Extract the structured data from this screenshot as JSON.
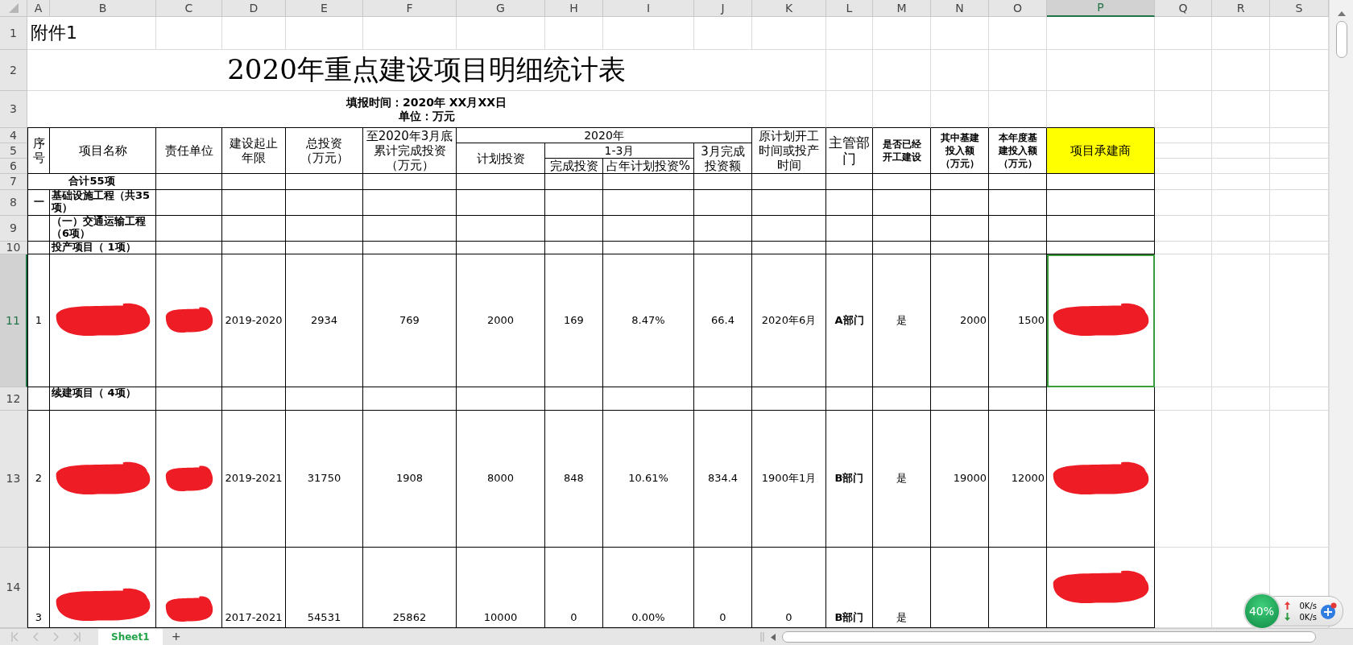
{
  "column_headers": [
    {
      "label": "A",
      "selected": false
    },
    {
      "label": "B",
      "selected": false
    },
    {
      "label": "C",
      "selected": false
    },
    {
      "label": "D",
      "selected": false
    },
    {
      "label": "E",
      "selected": false
    },
    {
      "label": "F",
      "selected": false
    },
    {
      "label": "G",
      "selected": false
    },
    {
      "label": "H",
      "selected": false
    },
    {
      "label": "I",
      "selected": false
    },
    {
      "label": "J",
      "selected": false
    },
    {
      "label": "K",
      "selected": false
    },
    {
      "label": "L",
      "selected": false
    },
    {
      "label": "M",
      "selected": false
    },
    {
      "label": "N",
      "selected": false
    },
    {
      "label": "O",
      "selected": false
    },
    {
      "label": "P",
      "selected": true
    },
    {
      "label": "Q",
      "selected": false
    },
    {
      "label": "R",
      "selected": false
    },
    {
      "label": "S",
      "selected": false
    }
  ],
  "row_headers": [
    {
      "label": "1",
      "selected": false
    },
    {
      "label": "2",
      "selected": false
    },
    {
      "label": "3",
      "selected": false
    },
    {
      "label": "4",
      "selected": false
    },
    {
      "label": "5",
      "selected": false
    },
    {
      "label": "6",
      "selected": false
    },
    {
      "label": "7",
      "selected": false
    },
    {
      "label": "8",
      "selected": false
    },
    {
      "label": "9",
      "selected": false
    },
    {
      "label": "10",
      "selected": false
    },
    {
      "label": "11",
      "selected": true
    },
    {
      "label": "12",
      "selected": false
    },
    {
      "label": "13",
      "selected": false
    },
    {
      "label": "14",
      "selected": false
    }
  ],
  "attachment": "附件1",
  "title": "2020年重点建设项目明细统计表",
  "report_date": "填报时间：2020年 XX月XX日",
  "unit": "单位：万元",
  "table_headers": [
    "序号",
    "项目名称",
    "责任单位",
    "建设起止年限",
    "总投资（万元）",
    "至2020年3月底累计完成投资（万元）",
    "2020年",
    "计划投资",
    "1-3月",
    "完成投资",
    "占年计划投资%",
    "3月完成投资额",
    "原计划开工时间或投产时间",
    "主管部门",
    "是否已经开工建设",
    "其中基建投入额（万元）",
    "本年度基建投入额（万元）",
    "项目承建商"
  ],
  "rows": [
    {
      "kind": "total",
      "label": "合计55项"
    },
    {
      "kind": "section",
      "number": "一",
      "label": "基础设施工程（共35项）"
    },
    {
      "kind": "section",
      "label": "（一）交通运输工程（6项）"
    },
    {
      "kind": "section",
      "label": "投产项目（ 1项）"
    },
    {
      "kind": "project",
      "cells": [
        {
          "kind": "text",
          "text": "1"
        },
        {
          "kind": "redacted"
        },
        {
          "kind": "redacted"
        },
        {
          "kind": "text",
          "text": "2019-2020"
        },
        {
          "kind": "text",
          "text": "2934"
        },
        {
          "kind": "text",
          "text": "769"
        },
        {
          "kind": "text",
          "text": "2000"
        },
        {
          "kind": "text",
          "text": "169"
        },
        {
          "kind": "text",
          "text": "8.47%"
        },
        {
          "kind": "text",
          "text": "66.4"
        },
        {
          "kind": "text",
          "text": "2020年6月"
        },
        {
          "kind": "text",
          "text": "A部门"
        },
        {
          "kind": "text",
          "text": "是"
        },
        {
          "kind": "text",
          "text": "2000"
        },
        {
          "kind": "text",
          "text": "1500"
        },
        {
          "kind": "redacted"
        }
      ]
    },
    {
      "kind": "section",
      "label": "续建项目（ 4项）"
    },
    {
      "kind": "project",
      "cells": [
        {
          "kind": "text",
          "text": "2"
        },
        {
          "kind": "redacted"
        },
        {
          "kind": "redacted"
        },
        {
          "kind": "text",
          "text": "2019-2021"
        },
        {
          "kind": "text",
          "text": "31750"
        },
        {
          "kind": "text",
          "text": "1908"
        },
        {
          "kind": "text",
          "text": "8000"
        },
        {
          "kind": "text",
          "text": "848"
        },
        {
          "kind": "text",
          "text": "10.61%"
        },
        {
          "kind": "text",
          "text": "834.4"
        },
        {
          "kind": "text",
          "text": "1900年1月"
        },
        {
          "kind": "text",
          "text": "B部门"
        },
        {
          "kind": "text",
          "text": "是"
        },
        {
          "kind": "text",
          "text": "19000"
        },
        {
          "kind": "text",
          "text": "12000"
        },
        {
          "kind": "redacted"
        }
      ]
    },
    {
      "kind": "project",
      "cells": [
        {
          "kind": "text",
          "text": "3"
        },
        {
          "kind": "redacted"
        },
        {
          "kind": "redacted"
        },
        {
          "kind": "text",
          "text": "2017-2021"
        },
        {
          "kind": "text",
          "text": "54531"
        },
        {
          "kind": "text",
          "text": "25862"
        },
        {
          "kind": "text",
          "text": "10000"
        },
        {
          "kind": "text",
          "text": "0"
        },
        {
          "kind": "text",
          "text": "0.00%"
        },
        {
          "kind": "text",
          "text": "0"
        },
        {
          "kind": "text",
          "text": "0"
        },
        {
          "kind": "text",
          "text": "B部门"
        },
        {
          "kind": "text",
          "text": "是"
        },
        {
          "kind": "blank"
        },
        {
          "kind": "blank"
        },
        {
          "kind": "redacted"
        }
      ]
    }
  ],
  "sheet_tabs": [
    {
      "label": "Sheet1",
      "selected": true
    }
  ],
  "add_sheet": "+",
  "network_monitor": {
    "percent": "40%",
    "upload": "0K/s",
    "download": "0K/s"
  }
}
